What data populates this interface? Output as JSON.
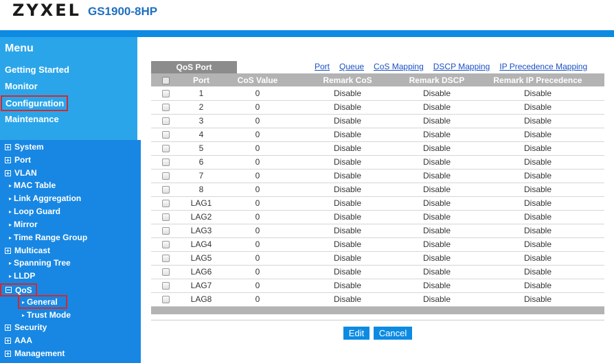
{
  "header": {
    "brand": "ZYXEL",
    "model": "GS1900-8HP"
  },
  "menu": {
    "title": "Menu",
    "items": [
      "Getting Started",
      "Monitor",
      "Configuration",
      "Maintenance"
    ]
  },
  "tree": {
    "system": "System",
    "port": "Port",
    "vlan": "VLAN",
    "mac_table": "MAC Table",
    "link_aggregation": "Link Aggregation",
    "loop_guard": "Loop Guard",
    "mirror": "Mirror",
    "time_range_group": "Time Range Group",
    "multicast": "Multicast",
    "spanning_tree": "Spanning Tree",
    "lldp": "LLDP",
    "qos": "QoS",
    "general": "General",
    "trust_mode": "Trust Mode",
    "security": "Security",
    "aaa": "AAA",
    "management": "Management"
  },
  "main": {
    "tab_label": "QoS Port",
    "links": [
      "Port",
      "Queue",
      "CoS Mapping",
      "DSCP Mapping",
      "IP Precedence Mapping"
    ],
    "columns": [
      "Port",
      "CoS Value",
      "Remark CoS",
      "Remark DSCP",
      "Remark IP Precedence"
    ],
    "rows": [
      {
        "port": "1",
        "cos": "0",
        "rc": "Disable",
        "rd": "Disable",
        "rip": "Disable"
      },
      {
        "port": "2",
        "cos": "0",
        "rc": "Disable",
        "rd": "Disable",
        "rip": "Disable"
      },
      {
        "port": "3",
        "cos": "0",
        "rc": "Disable",
        "rd": "Disable",
        "rip": "Disable"
      },
      {
        "port": "4",
        "cos": "0",
        "rc": "Disable",
        "rd": "Disable",
        "rip": "Disable"
      },
      {
        "port": "5",
        "cos": "0",
        "rc": "Disable",
        "rd": "Disable",
        "rip": "Disable"
      },
      {
        "port": "6",
        "cos": "0",
        "rc": "Disable",
        "rd": "Disable",
        "rip": "Disable"
      },
      {
        "port": "7",
        "cos": "0",
        "rc": "Disable",
        "rd": "Disable",
        "rip": "Disable"
      },
      {
        "port": "8",
        "cos": "0",
        "rc": "Disable",
        "rd": "Disable",
        "rip": "Disable"
      },
      {
        "port": "LAG1",
        "cos": "0",
        "rc": "Disable",
        "rd": "Disable",
        "rip": "Disable"
      },
      {
        "port": "LAG2",
        "cos": "0",
        "rc": "Disable",
        "rd": "Disable",
        "rip": "Disable"
      },
      {
        "port": "LAG3",
        "cos": "0",
        "rc": "Disable",
        "rd": "Disable",
        "rip": "Disable"
      },
      {
        "port": "LAG4",
        "cos": "0",
        "rc": "Disable",
        "rd": "Disable",
        "rip": "Disable"
      },
      {
        "port": "LAG5",
        "cos": "0",
        "rc": "Disable",
        "rd": "Disable",
        "rip": "Disable"
      },
      {
        "port": "LAG6",
        "cos": "0",
        "rc": "Disable",
        "rd": "Disable",
        "rip": "Disable"
      },
      {
        "port": "LAG7",
        "cos": "0",
        "rc": "Disable",
        "rd": "Disable",
        "rip": "Disable"
      },
      {
        "port": "LAG8",
        "cos": "0",
        "rc": "Disable",
        "rd": "Disable",
        "rip": "Disable"
      }
    ],
    "buttons": {
      "edit": "Edit",
      "cancel": "Cancel"
    }
  },
  "colors": {
    "accent_blue": "#0d8be3",
    "menu_panel": "#2aa5ea",
    "tree_panel": "#1787e3",
    "highlight_red": "#d8262c",
    "header_gray": "#b3b3b3"
  }
}
